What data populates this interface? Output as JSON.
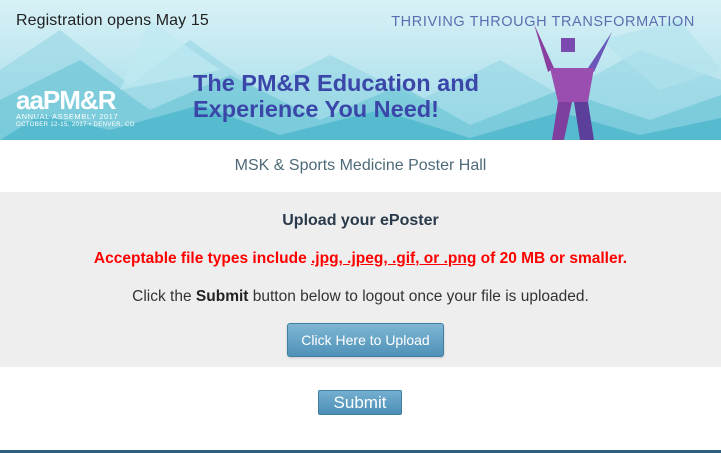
{
  "banner": {
    "registration": "Registration opens May 15",
    "tagline": "THRIVING THROUGH TRANSFORMATION",
    "headline_line1": "The PM&R Education and",
    "headline_line2": "Experience You Need!",
    "logo_mark": "aaPM&R",
    "logo_sub": "ANNUAL ASSEMBLY 2017",
    "logo_dates": "OCTOBER 12-15, 2017 • DENVER, CO"
  },
  "hall_title": "MSK & Sports Medicine Poster Hall",
  "panel": {
    "heading": "Upload your ePoster",
    "file_types_prefix": "Acceptable file types include ",
    "file_types_ext": ".jpg, .jpeg, .gif, or .png",
    "file_types_suffix": " of 20 MB or smaller.",
    "instr_prefix": "Click the ",
    "instr_bold": "Submit",
    "instr_suffix": " button below to logout once your file is uploaded.",
    "upload_label": "Click Here to Upload"
  },
  "submit_label": "Submit",
  "colors": {
    "accent_blue": "#4f92b8",
    "warning_red": "#ff0000",
    "headline_blue": "#3a46a8",
    "panel_grey": "#eeeeee"
  }
}
